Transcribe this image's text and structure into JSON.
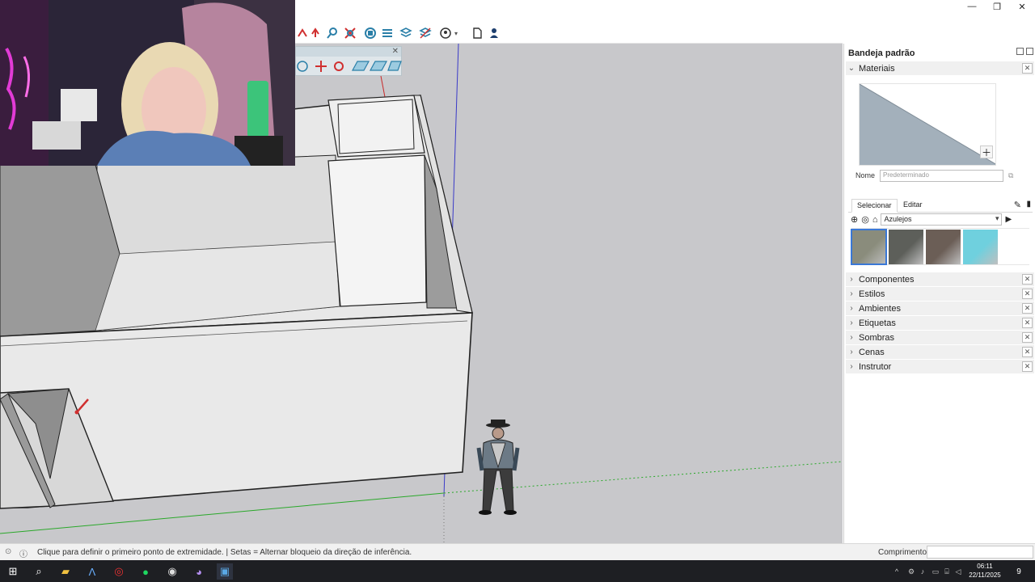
{
  "window": {
    "minimize": "—",
    "restore": "❐",
    "close": "✕"
  },
  "tray": {
    "title": "Bandeja padrão",
    "materials": {
      "header": "Materiais",
      "name_label": "Nome",
      "name_placeholder": "Predeterminado",
      "tab_select": "Selecionar",
      "tab_edit": "Editar",
      "library": "Azulejos",
      "swatches": [
        {
          "name": "tile-swatch-1",
          "color": "#8a8c7c"
        },
        {
          "name": "tile-swatch-2",
          "color": "#5d5f5a"
        },
        {
          "name": "tile-swatch-3",
          "color": "#6b5e56"
        },
        {
          "name": "tile-swatch-4",
          "color": "#6fd0de"
        }
      ]
    },
    "sections": [
      "Componentes",
      "Estilos",
      "Ambientes",
      "Etiquetas",
      "Sombras",
      "Cenas",
      "Instrutor"
    ]
  },
  "status": {
    "hint": "Clique para definir o primeiro ponto de extremidade. | Setas = Alternar bloqueio da direção de inferência.",
    "measure_label": "Comprimento",
    "measure_value": ""
  },
  "clock": {
    "time": "06:11",
    "date": "22/11/2025"
  },
  "notification_count": "9",
  "colors": {
    "accent": "#2a7fa8",
    "axis_blue": "#3a3ac8",
    "axis_green": "#2aa82a",
    "axis_red": "#c82a2a",
    "viewport_bg": "#c8c8cb"
  }
}
